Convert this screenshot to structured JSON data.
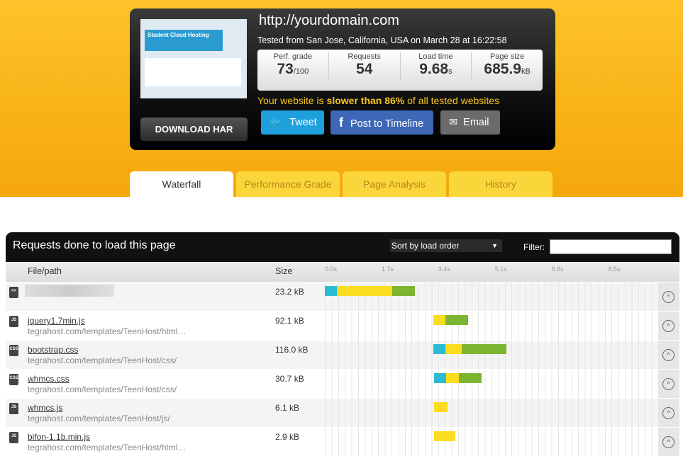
{
  "header": {
    "url": "http://yourdomain.com",
    "tested": "Tested from San Jose, California, USA on March 28 at 16:22:58",
    "thumbnail_text": "Student Cloud Hosting",
    "download": "DOWNLOAD HAR",
    "stats": [
      {
        "label": "Perf. grade",
        "value": "73",
        "unit": "/100"
      },
      {
        "label": "Requests",
        "value": "54",
        "unit": ""
      },
      {
        "label": "Load time",
        "value": "9.68",
        "unit": "s"
      },
      {
        "label": "Page size",
        "value": "685.9",
        "unit": "kB"
      }
    ],
    "slow_prefix": "Your website is ",
    "slow_bold": "slower than 86%",
    "slow_suffix": " of all tested websites",
    "share": {
      "tweet": "Tweet",
      "timeline": "Post to Timeline",
      "email": "Email"
    }
  },
  "tabs": [
    {
      "label": "Waterfall",
      "active": true
    },
    {
      "label": "Performance Grade"
    },
    {
      "label": "Page Analysis"
    },
    {
      "label": "History"
    }
  ],
  "panel": {
    "title": "Requests done to load this page",
    "sort": "Sort by load order",
    "filter_label": "Filter:",
    "filter_value": "",
    "col_file": "File/path",
    "col_size": "Size",
    "ticks": [
      "0.0s",
      "1.7s",
      "3.4s",
      "5.1s",
      "6.8s",
      "8.5s"
    ],
    "colors": {
      "dns": "#2bbcd4",
      "wait": "#fbdc1f",
      "receive": "#7cb52f"
    },
    "rows": [
      {
        "icon": "html",
        "name": "",
        "path": "",
        "size": "23.2 kB",
        "start": 0,
        "dns": 0.36,
        "wait": 1.66,
        "receive": 0.68
      },
      {
        "icon": "js",
        "name": "jquery1.7min.js",
        "path": "tegrahost.com/templates/TeenHost/html…",
        "size": "92.1 kB",
        "start": 3.26,
        "dns": 0,
        "wait": 0.36,
        "receive": 0.68
      },
      {
        "icon": "css",
        "name": "bootstrap.css",
        "path": "tegrahost.com/templates/TeenHost/css/",
        "size": "116.0 kB",
        "start": 3.26,
        "dns": 0.36,
        "wait": 0.49,
        "receive": 1.34
      },
      {
        "icon": "css",
        "name": "whmcs.css",
        "path": "tegrahost.com/templates/TeenHost/css/",
        "size": "30.7 kB",
        "start": 3.28,
        "dns": 0.36,
        "wait": 0.38,
        "receive": 0.68
      },
      {
        "icon": "js",
        "name": "whmcs.js",
        "path": "tegrahost.com/templates/TeenHost/js/",
        "size": "6.1 kB",
        "start": 3.28,
        "dns": 0,
        "wait": 0.4,
        "receive": 0
      },
      {
        "icon": "js",
        "name": "bifon-1.1b.min.js",
        "path": "tegrahost.com/templates/TeenHost/html…",
        "size": "2.9 kB",
        "start": 3.28,
        "dns": 0,
        "wait": 0.64,
        "receive": 0
      }
    ]
  }
}
